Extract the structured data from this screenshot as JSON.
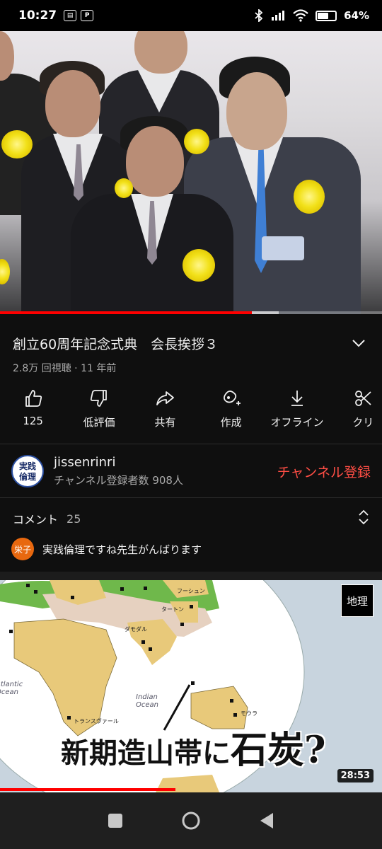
{
  "status_bar": {
    "time": "10:27",
    "left_icons": [
      "news-icon",
      "paypay-icon"
    ],
    "right_icons": [
      "bluetooth-icon",
      "signal-icon",
      "wifi-icon",
      "battery-icon"
    ],
    "battery_percent": "64%",
    "battery_level": 0.64,
    "mini_icon_2": "P"
  },
  "player": {
    "progress_played": 0.66,
    "progress_buffered": 0.73
  },
  "video": {
    "title": "創立60周年記念式典　会長挨拶３",
    "meta": "2.8万 回視聴 · 11 年前"
  },
  "actions": [
    {
      "icon": "thumbs-up-icon",
      "label": "125"
    },
    {
      "icon": "thumbs-down-icon",
      "label": "低評価"
    },
    {
      "icon": "share-icon",
      "label": "共有"
    },
    {
      "icon": "remix-icon",
      "label": "作成"
    },
    {
      "icon": "download-icon",
      "label": "オフライン"
    },
    {
      "icon": "clip-icon",
      "label": "クリ"
    }
  ],
  "channel": {
    "avatar_text": [
      "実践",
      "倫理"
    ],
    "name": "jissenrinri",
    "subscribers": "チャンネル登録者数 908人",
    "subscribe_label": "チャンネル登録"
  },
  "comments": {
    "label": "コメント",
    "count": "25",
    "top_comment": {
      "avatar_text": "栄子",
      "text": "実践倫理ですね先生がんばります"
    }
  },
  "next_video": {
    "badge": "地理",
    "caption_small_1": "新期造山帯に",
    "caption_big": "石炭",
    "caption_small_2": "?",
    "duration": "28:53",
    "watched_fraction": 0.46,
    "map_labels": [
      "フーシュン",
      "タートン",
      "ダモダル",
      "トランスヴァール",
      "モウラ"
    ],
    "ocean_labels": [
      "Indian Ocean",
      "Atlantic Ocean"
    ]
  },
  "nav": [
    "recents-icon",
    "home-icon",
    "back-icon"
  ],
  "colors": {
    "accent_red": "#ff0000",
    "subscribe_red": "#ff4e45",
    "background": "#0f0f0f"
  }
}
